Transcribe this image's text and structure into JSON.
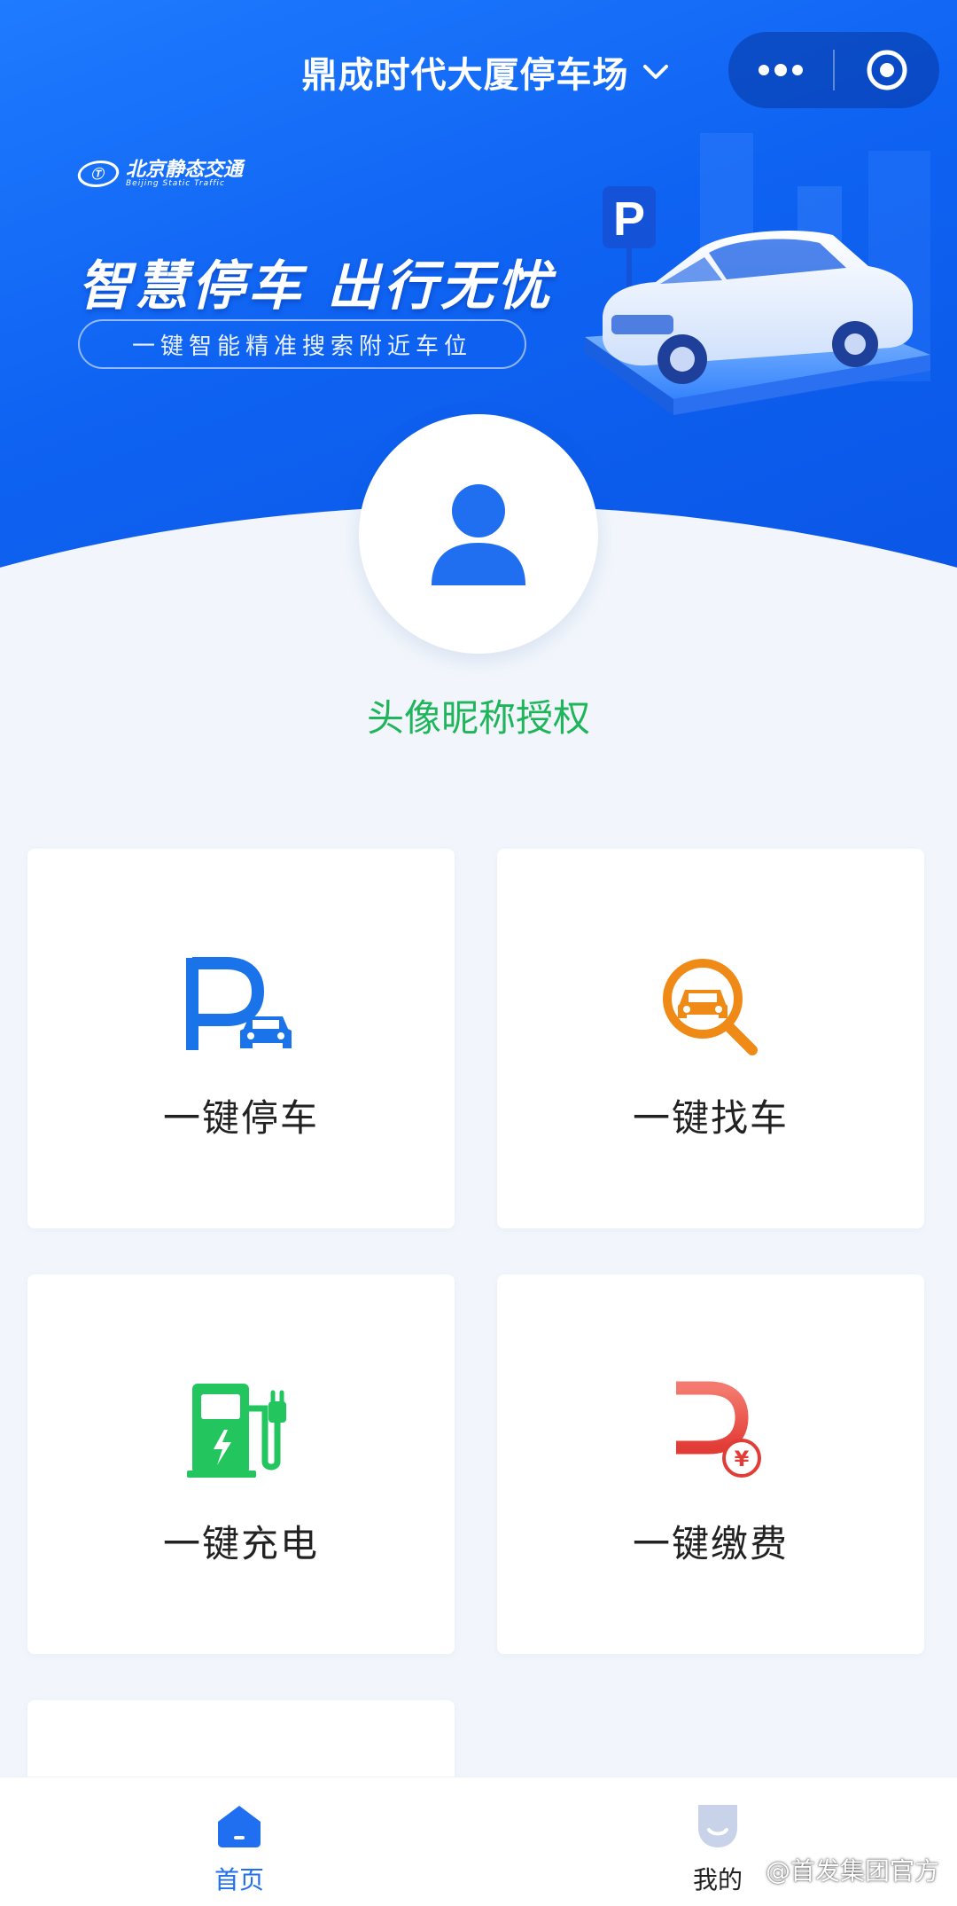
{
  "header": {
    "title": "鼎成时代大厦停车场",
    "title_dropdown_icon": "chevron-down-icon",
    "capsule": {
      "more_icon": "more-dots-icon",
      "close_icon": "target-circle-icon"
    }
  },
  "banner": {
    "brand_name": "北京静态交通",
    "brand_sub": "Beijing Static Traffic",
    "slogan": "智慧停车 出行无忧",
    "sub_slogan": "一键智能精准搜索附近车位",
    "illustration": "car-parking-illustration"
  },
  "profile": {
    "avatar_icon": "user-avatar-icon",
    "auth_text": "头像昵称授权"
  },
  "features": [
    {
      "label": "一键停车",
      "icon": "parking-car-icon",
      "color": "#1a73e8"
    },
    {
      "label": "一键找车",
      "icon": "find-car-icon",
      "color": "#ef8a17"
    },
    {
      "label": "一键充电",
      "icon": "ev-charging-icon",
      "color": "#22c55e"
    },
    {
      "label": "一键缴费",
      "icon": "parking-pay-icon",
      "color": "#e8453c"
    }
  ],
  "tabbar": {
    "home_label": "首页",
    "mine_label": "我的"
  },
  "watermark": "@首发集团官方",
  "colors": {
    "primary": "#0f63f2",
    "auth_green": "#1fb55a",
    "background": "#f2f6fc"
  }
}
